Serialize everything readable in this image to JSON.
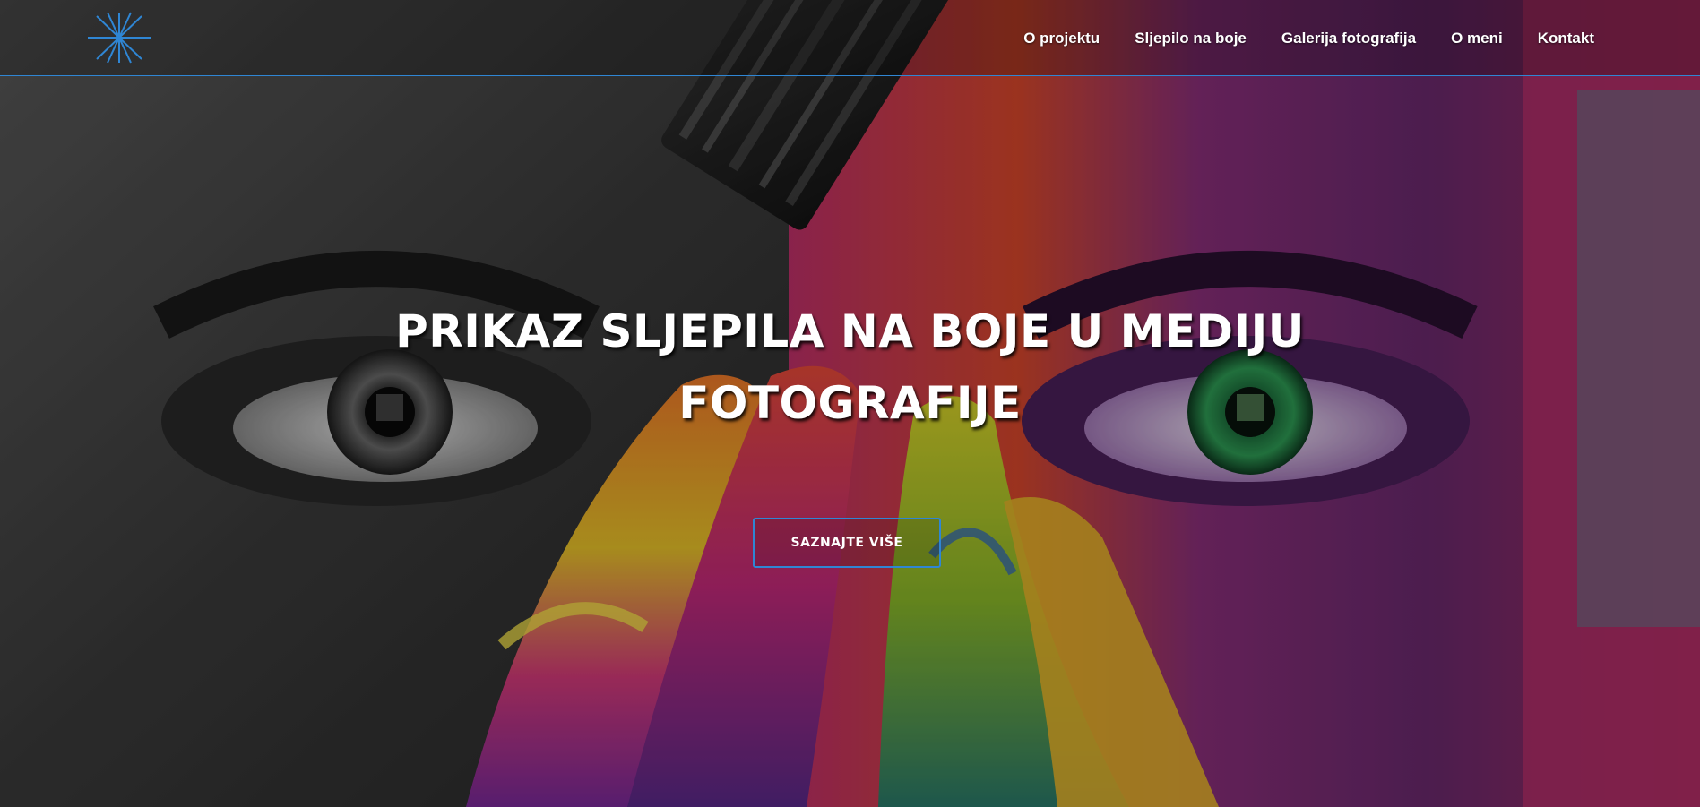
{
  "navbar": {
    "logo_icon": "star-logo-icon",
    "items": [
      {
        "label": "O projektu"
      },
      {
        "label": "Sljepilo na boje"
      },
      {
        "label": "Galerija fotografija"
      },
      {
        "label": "O meni"
      },
      {
        "label": "Kontakt"
      }
    ]
  },
  "hero": {
    "title": "PRIKAZ SLJEPILA NA BOJE U MEDIJU FOTOGRAFIJE",
    "cta_label": "SAZNAJTE VIŠE",
    "background_description_icon": "painted-face-photo",
    "left_half_style": "grayscale",
    "right_half_style": "colorful"
  },
  "colors": {
    "accent": "#2f86d4",
    "text": "#ffffff"
  }
}
